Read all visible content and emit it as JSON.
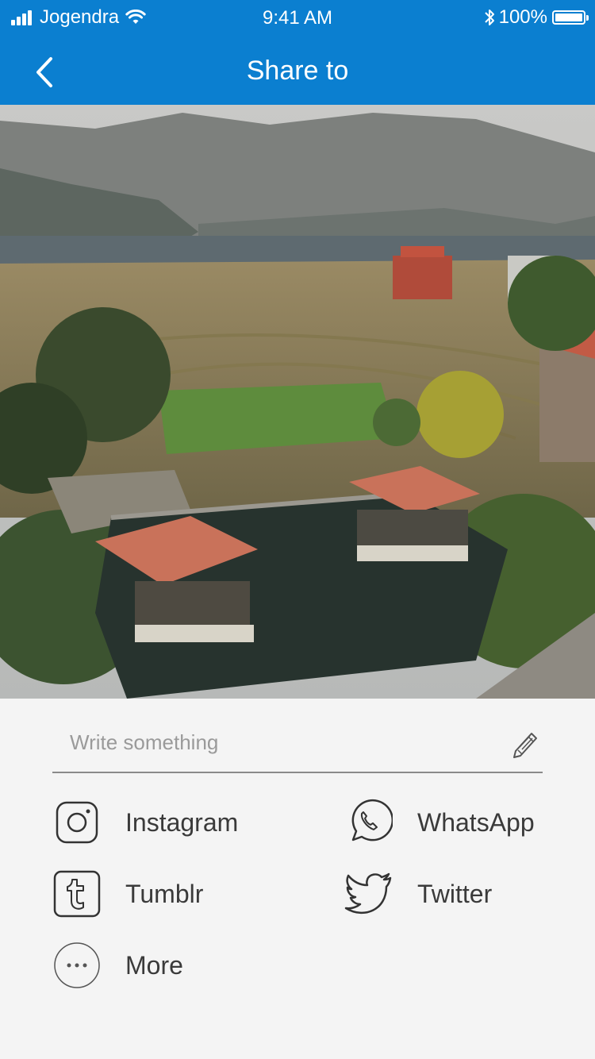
{
  "status_bar": {
    "carrier": "Jogendra",
    "time": "9:41 AM",
    "battery": "100%"
  },
  "header": {
    "title": "Share to"
  },
  "composer": {
    "placeholder": "Write something"
  },
  "share_targets": [
    {
      "label": "Instagram",
      "icon": "instagram-icon"
    },
    {
      "label": "WhatsApp",
      "icon": "whatsapp-icon"
    },
    {
      "label": "Tumblr",
      "icon": "tumblr-icon"
    },
    {
      "label": "Twitter",
      "icon": "twitter-icon"
    },
    {
      "label": "More",
      "icon": "more-icon"
    }
  ],
  "colors": {
    "header": "#0b7fd0",
    "background": "#f4f4f4",
    "text": "#3a3a3a"
  }
}
